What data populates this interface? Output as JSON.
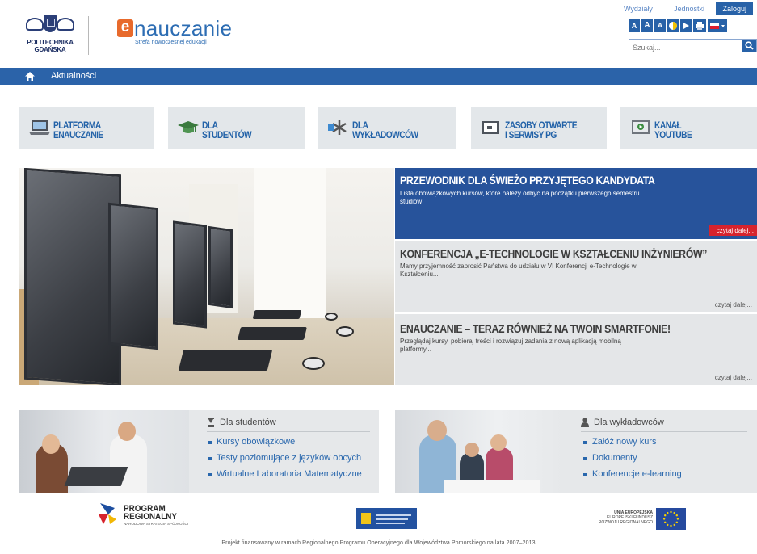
{
  "header": {
    "university_name": [
      "POLITECHNIKA",
      "GDAŃSKA"
    ],
    "brand_letter": "e",
    "brand_word": "nauczanie",
    "brand_tagline": "Strefa nowoczesnej edukacji",
    "top_links": [
      "Wydziały",
      "Jednostki"
    ],
    "login": "Zaloguj",
    "font_sizes": [
      "A",
      "A",
      "A"
    ],
    "tool_icons": [
      "contrast-icon",
      "pointer-icon",
      "print-icon",
      "flag-pl-icon"
    ],
    "search_placeholder": "Szukaj..."
  },
  "nav": {
    "home_icon": "home-icon",
    "items": [
      "Aktualności"
    ]
  },
  "tiles": [
    {
      "line1": "PLATFORMA",
      "line2": "eNAUCZANIE",
      "icon": "laptop-icon"
    },
    {
      "line1": "DLA",
      "line2": "STUDENTÓW",
      "icon": "graduation-cap-icon"
    },
    {
      "line1": "DLA",
      "line2": "WYKŁADOWCÓW",
      "icon": "pointer-hand-icon"
    },
    {
      "line1": "ZASOBY OTWARTE",
      "line2": "I SERWISY PG",
      "icon": "documents-icon"
    },
    {
      "line1": "KANAŁ",
      "line2": "YOUTUBE",
      "icon": "video-icon"
    }
  ],
  "news": [
    {
      "title": "PRZEWODNIK DLA ŚWIEŻO PRZYJĘTEGO KANDYDATA",
      "lines": [
        "Lista obowiązkowych kursów, które należy odbyć na początku pierwszego semestru",
        "studiów"
      ],
      "more": "czytaj dalej..."
    },
    {
      "title": "KONFERENCJA „E-TECHNOLOGIE W KSZTAŁCENIU INŻYNIERÓW”",
      "lines": [
        "Mamy przyjemność zaprosić Państwa do udziału w VI Konferencji e-Technologie w",
        "Kształceniu..."
      ],
      "more": "czytaj dalej..."
    },
    {
      "title": "ENAUCZANIE – TERAZ RÓWNIEŻ NA TWOIN SMARTFONIE!",
      "lines": [
        "Przeglądaj kursy, pobieraj treści i rozwiązuj zadania z nową aplikacją mobilną",
        "platformy..."
      ],
      "more": "czytaj dalej..."
    }
  ],
  "panels": {
    "students": {
      "title": "Dla studentów",
      "links": [
        "Kursy obowiązkowe",
        "Testy poziomujące z języków obcych",
        "Wirtualne Laboratoria Matematyczne"
      ]
    },
    "lecturers": {
      "title": "Dla wykładowców",
      "links": [
        "Załóż nowy kurs",
        "Dokumenty",
        "Konferencje e-learning"
      ]
    }
  },
  "footer": {
    "program": [
      "PROGRAM",
      "REGIONALNY"
    ],
    "program_sub": "NARODOWA STRATEGIA SPÓJNOŚCI",
    "eu": [
      "UNIA EUROPEJSKA",
      "EUROPEJSKI FUNDUSZ",
      "ROZWOJU REGIONALNEGO"
    ],
    "note": "Projekt finansowany w ramach Regionalnego Programu Operacyjnego dla Województwa Pomorskiego na lata 2007–2013"
  }
}
